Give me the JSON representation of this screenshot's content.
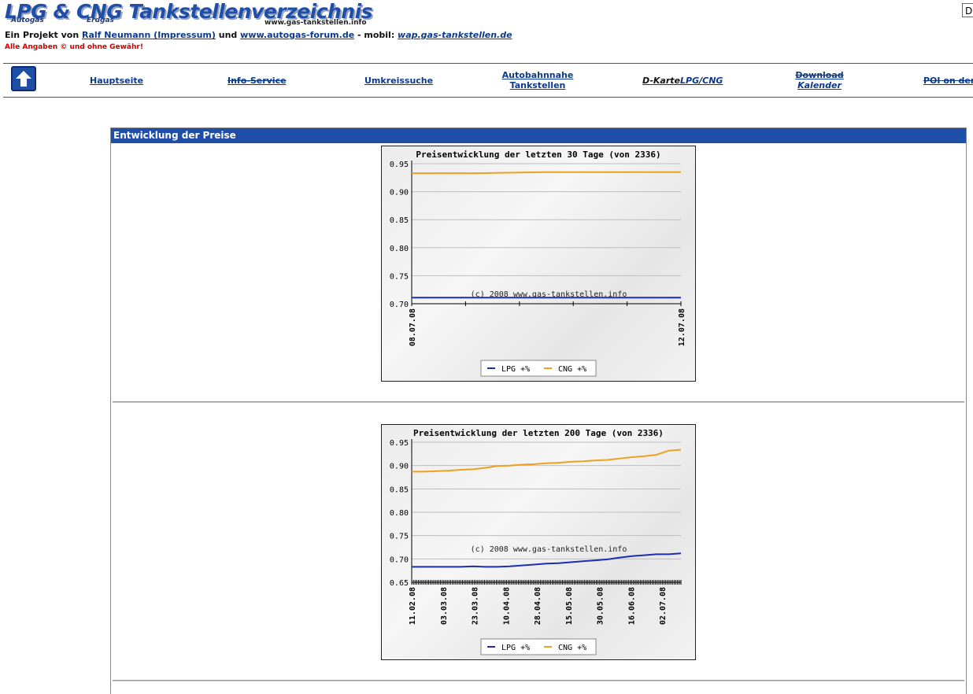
{
  "header": {
    "logo_main": "LPG & CNG Tankstellenverzeichnis",
    "logo_autogas": "Autogas",
    "logo_erdgas": "Erdgas",
    "logo_domain": "www.gas-tankstellen.info",
    "intro_prefix": "Ein Projekt von ",
    "link_ralf": "Ralf Neumann (Impressum)",
    "intro_und": " und ",
    "link_forum": "www.autogas-forum.de",
    "intro_mobil": " - mobil: ",
    "link_wap": "wap.gas-tankstellen.de",
    "warning": "Alle Angaben © und ohne Gewähr!",
    "corner_box": "D"
  },
  "nav": {
    "home_icon": "up-arrow-icon",
    "items": [
      {
        "label": "Hauptseite"
      },
      {
        "label": "Info-Service"
      },
      {
        "label": "Umkreissuche"
      },
      {
        "line1": "Autobahnnahe",
        "line2": "Tankstellen"
      },
      {
        "prefix": "D-Karte",
        "lpg": "LPG",
        "sep": "/",
        "cng": "CNG"
      },
      {
        "line1": "Download",
        "line2": "Kalender"
      },
      {
        "label": "POI on dem"
      }
    ]
  },
  "panel": {
    "title": "Entwicklung der Preise"
  },
  "chart_data": [
    {
      "type": "line",
      "title": "Preisentwicklung der letzten 30 Tage (von 2336)",
      "watermark": "(c) 2008 www.gas-tankstellen.info",
      "ylim": [
        0.7,
        0.95
      ],
      "yticks": [
        "0.95",
        "0.90",
        "0.85",
        "0.80",
        "0.75",
        "0.70"
      ],
      "x_tick_labels": [
        "08.07.08",
        "12.07.08"
      ],
      "x_tick_count": 6,
      "series": [
        {
          "name": "LPG +%",
          "color": "#1a2fb0",
          "values": [
            0.711,
            0.711,
            0.711,
            0.711,
            0.711
          ]
        },
        {
          "name": "CNG +%",
          "color": "#f0a020",
          "values": [
            0.933,
            0.933,
            0.935,
            0.935,
            0.935
          ]
        }
      ],
      "grid": true,
      "legend": "bottom"
    },
    {
      "type": "line",
      "title": "Preisentwicklung der letzten 200 Tage (von 2336)",
      "watermark": "(c) 2008 www.gas-tankstellen.info",
      "ylim": [
        0.65,
        0.95
      ],
      "yticks": [
        "0.95",
        "0.90",
        "0.85",
        "0.80",
        "0.75",
        "0.70",
        "0.65"
      ],
      "x_tick_labels": [
        "11.02.08",
        "03.03.08",
        "23.03.08",
        "10.04.08",
        "28.04.08",
        "15.05.08",
        "30.05.08",
        "16.06.08",
        "02.07.08"
      ],
      "x_tick_count": 160,
      "series": [
        {
          "name": "LPG +%",
          "color": "#1a2fb0",
          "values": [
            0.683,
            0.683,
            0.683,
            0.683,
            0.683,
            0.684,
            0.683,
            0.683,
            0.684,
            0.686,
            0.688,
            0.69,
            0.691,
            0.693,
            0.695,
            0.697,
            0.699,
            0.703,
            0.706,
            0.708,
            0.71,
            0.71,
            0.712
          ]
        },
        {
          "name": "CNG +%",
          "color": "#f0a020",
          "values": [
            0.887,
            0.887,
            0.888,
            0.889,
            0.891,
            0.892,
            0.895,
            0.899,
            0.9,
            0.902,
            0.903,
            0.905,
            0.906,
            0.908,
            0.909,
            0.911,
            0.912,
            0.915,
            0.918,
            0.92,
            0.923,
            0.932,
            0.934
          ]
        }
      ],
      "grid": true,
      "legend": "bottom"
    }
  ]
}
